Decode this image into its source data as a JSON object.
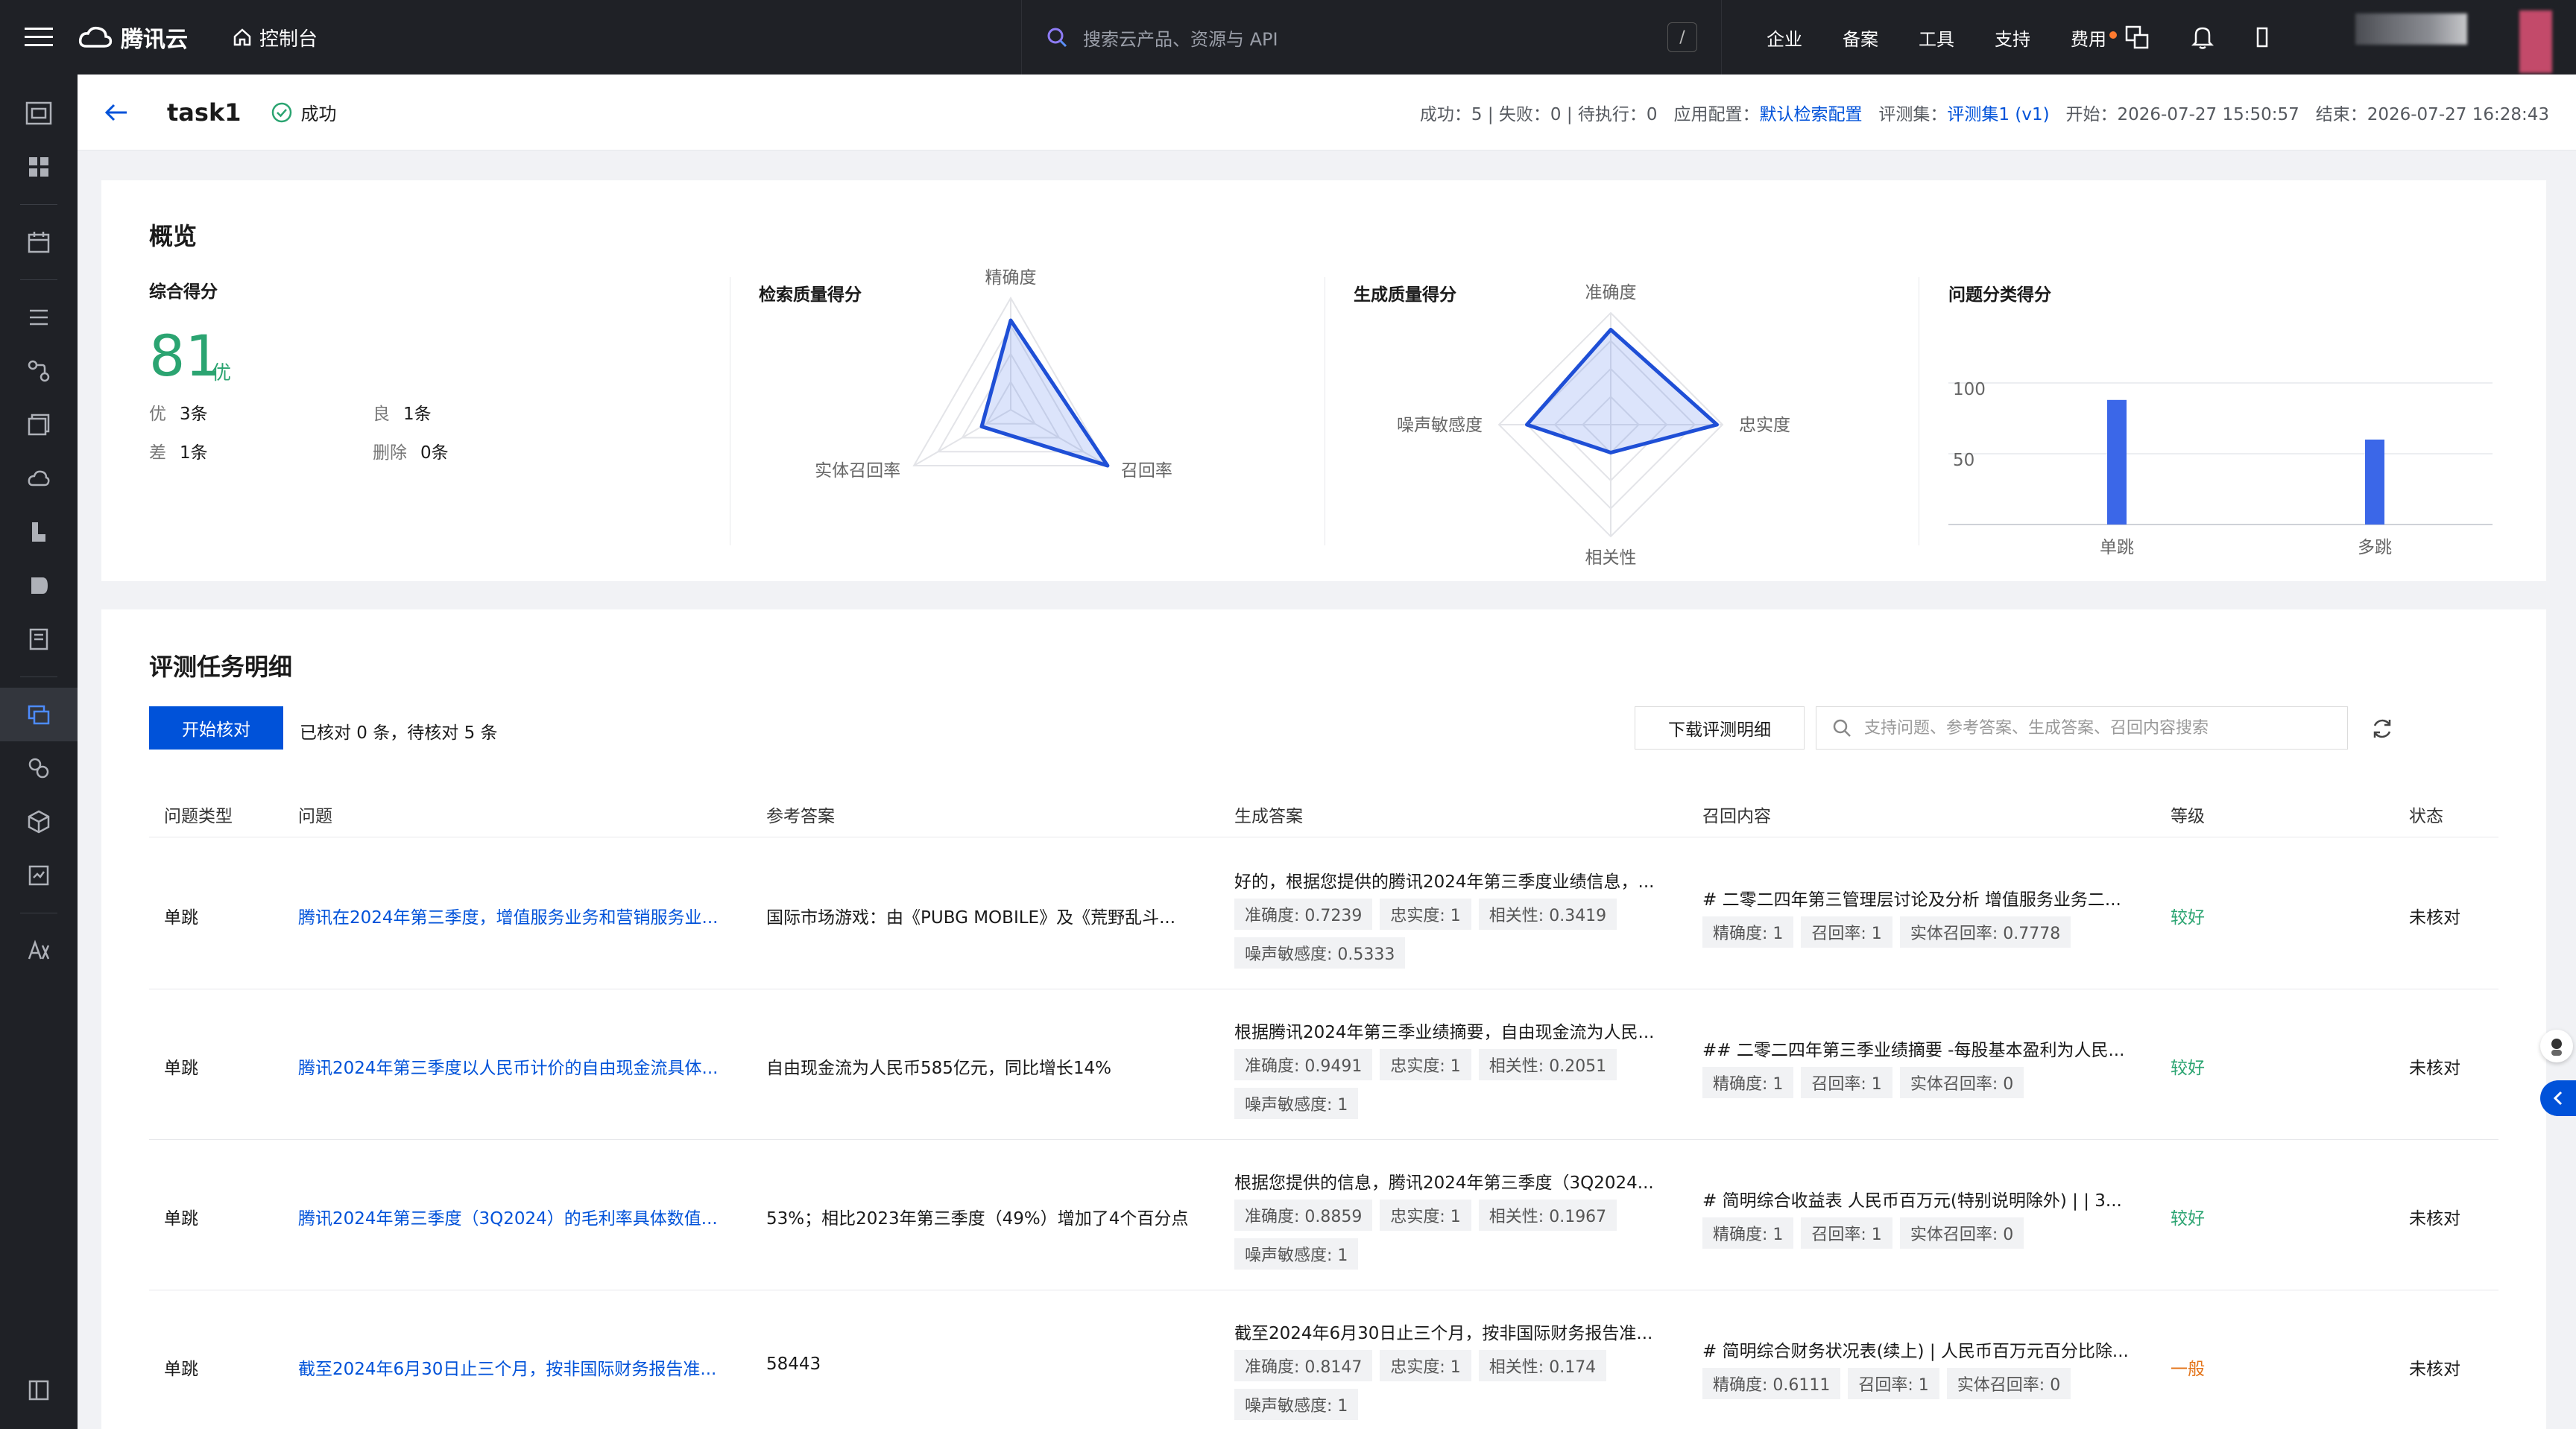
{
  "topbar": {
    "brand": "腾讯云",
    "console": "控制台",
    "search_placeholder": "搜索云产品、资源与 API",
    "slash": "/",
    "nav": [
      "企业",
      "备案",
      "工具",
      "支持",
      "费用"
    ]
  },
  "task": {
    "title": "task1",
    "status": "成功",
    "meta": {
      "success": "成功：5",
      "fail": "失败：0",
      "pending": "待执行：0",
      "config_label": "应用配置：",
      "config_value": "默认检索配置",
      "set_label": "评测集：",
      "set_value": "评测集1 (v1)",
      "start": "开始：2026-07-27 15:50:57",
      "end": "结束：2026-07-27 16:28:43"
    }
  },
  "overview": {
    "title": "概览",
    "total": {
      "label": "综合得分",
      "score": "81",
      "grade": "优",
      "counts": [
        {
          "k": "优",
          "v": "3条"
        },
        {
          "k": "良",
          "v": "1条"
        },
        {
          "k": "差",
          "v": "1条"
        },
        {
          "k": "删除",
          "v": "0条"
        }
      ]
    },
    "retrieval_label": "检索质量得分",
    "generation_label": "生成质量得分",
    "category_label": "问题分类得分"
  },
  "chart_data": [
    {
      "type": "radar",
      "title": "检索质量得分",
      "axes": [
        "精确度",
        "召回率",
        "实体召回率"
      ],
      "values": [
        0.8,
        1.0,
        0.3
      ],
      "range": [
        0,
        1
      ]
    },
    {
      "type": "radar",
      "title": "生成质量得分",
      "axes": [
        "准确度",
        "忠实度",
        "相关性",
        "噪声敏感度"
      ],
      "values": [
        0.85,
        0.95,
        0.25,
        0.75
      ],
      "range": [
        0,
        1
      ]
    },
    {
      "type": "bar",
      "title": "问题分类得分",
      "categories": [
        "单跳",
        "多跳"
      ],
      "values": [
        88,
        60
      ],
      "ylim": [
        0,
        100
      ],
      "yticks": [
        100,
        50
      ],
      "color": "#3b67e8"
    }
  ],
  "detail": {
    "title": "评测任务明细",
    "start_btn": "开始核对",
    "verify_info": "已核对 0 条，待核对 5 条",
    "download_btn": "下载评测明细",
    "search_placeholder": "支持问题、参考答案、生成答案、召回内容搜索",
    "columns": [
      "问题类型",
      "问题",
      "参考答案",
      "生成答案",
      "召回内容",
      "等级",
      "状态"
    ],
    "rows": [
      {
        "type": "单跳",
        "question": "腾讯在2024年第三季度，增值服务业务和营销服务业...",
        "reference": "国际市场游戏：由《PUBG MOBILE》及《荒野乱斗...",
        "answer": "好的，根据您提供的腾讯2024年第三季度业绩信息，...",
        "answer_tags": [
          "准确度: 0.7239",
          "忠实度: 1",
          "相关性: 0.3419",
          "噪声敏感度: 0.5333"
        ],
        "recall": "# 二零二四年第三管理层讨论及分析 增值服务业务二...",
        "recall_tags": [
          "精确度: 1",
          "召回率: 1",
          "实体召回率: 0.7778"
        ],
        "level": "较好",
        "status": "未核对"
      },
      {
        "type": "单跳",
        "question": "腾讯2024年第三季度以人民币计价的自由现金流具体...",
        "reference": "自由现金流为人民币585亿元，同比增长14%",
        "answer": "根据腾讯2024年第三季业绩摘要，自由现金流为人民...",
        "answer_tags": [
          "准确度: 0.9491",
          "忠实度: 1",
          "相关性: 0.2051",
          "噪声敏感度: 1"
        ],
        "recall": "## 二零二四年第三季业绩摘要 -每股基本盈利为人民...",
        "recall_tags": [
          "精确度: 1",
          "召回率: 1",
          "实体召回率: 0"
        ],
        "level": "较好",
        "status": "未核对"
      },
      {
        "type": "单跳",
        "question": "腾讯2024年第三季度（3Q2024）的毛利率具体数值...",
        "reference": "53%；相比2023年第三季度（49%）增加了4个百分点",
        "answer": "根据您提供的信息，腾讯2024年第三季度（3Q2024...",
        "answer_tags": [
          "准确度: 0.8859",
          "忠实度: 1",
          "相关性: 0.1967",
          "噪声敏感度: 1"
        ],
        "recall": "# 简明综合收益表 人民币百万元(特别说明除外) | | 3...",
        "recall_tags": [
          "精确度: 1",
          "召回率: 1",
          "实体召回率: 0"
        ],
        "level": "较好",
        "status": "未核对"
      },
      {
        "type": "单跳",
        "question": "截至2024年6月30日止三个月，按非国际财务报告准...",
        "reference": "58443",
        "answer": "截至2024年6月30日止三个月，按非国际财务报告准...",
        "answer_tags": [
          "准确度: 0.8147",
          "忠实度: 1",
          "相关性: 0.174",
          "噪声敏感度: 1"
        ],
        "recall": "# 简明综合财务状况表(续上) | 人民币百万元百分比除...",
        "recall_tags": [
          "精确度: 0.6111",
          "召回率: 1",
          "实体召回率: 0"
        ],
        "level": "一般",
        "status": "未核对"
      }
    ]
  },
  "colors": {
    "primary": "#0052d9",
    "success": "#2ba471",
    "warning": "#e37318",
    "topbar": "#1f2126"
  }
}
